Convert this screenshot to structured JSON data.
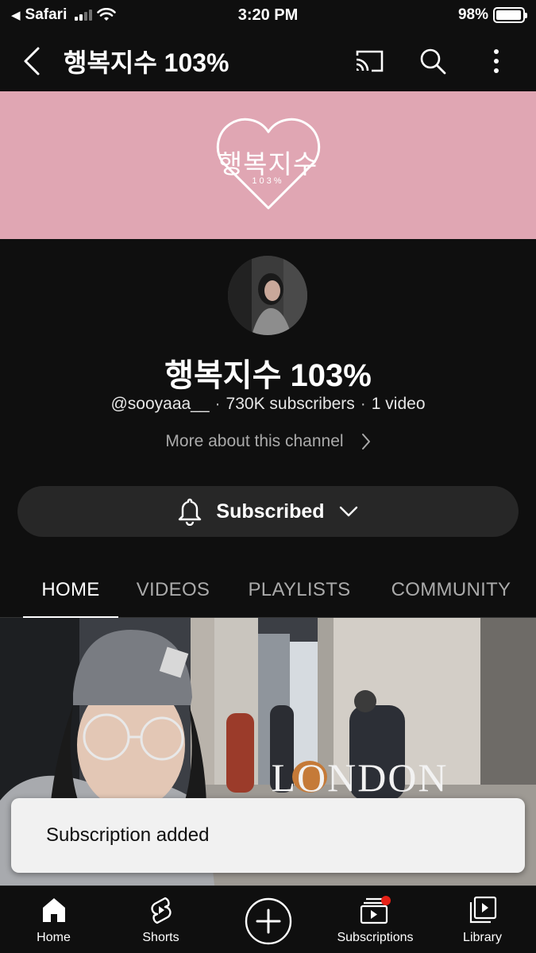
{
  "status_bar": {
    "carrier": "Safari",
    "time": "3:20 PM",
    "battery_pct": "98%"
  },
  "header": {
    "title": "행복지수 103%",
    "icons": [
      "back-icon",
      "cast-icon",
      "search-icon",
      "more-vertical-icon"
    ]
  },
  "banner": {
    "logo_text": "행복지수",
    "logo_sub": "103%",
    "background": "#e0a6b3"
  },
  "channel": {
    "name": "행복지수 103%",
    "handle": "@sooyaaa__",
    "subscribers": "730K subscribers",
    "videos": "1 video",
    "more_about": "More about this channel"
  },
  "subscribe": {
    "label": "Subscribed"
  },
  "tabs": [
    {
      "label": "HOME",
      "active": true
    },
    {
      "label": "VIDEOS",
      "active": false
    },
    {
      "label": "PLAYLISTS",
      "active": false
    },
    {
      "label": "COMMUNITY",
      "active": false
    }
  ],
  "video": {
    "overlay_text": "LONDON"
  },
  "toast": {
    "message": "Subscription added"
  },
  "bottom_nav": [
    {
      "label": "Home",
      "icon": "home-icon"
    },
    {
      "label": "Shorts",
      "icon": "shorts-icon"
    },
    {
      "label": "",
      "icon": "create-icon"
    },
    {
      "label": "Subscriptions",
      "icon": "subscriptions-icon"
    },
    {
      "label": "Library",
      "icon": "library-icon"
    }
  ],
  "colors": {
    "background": "#0f0f0f",
    "notification_dot": "#e62117"
  }
}
